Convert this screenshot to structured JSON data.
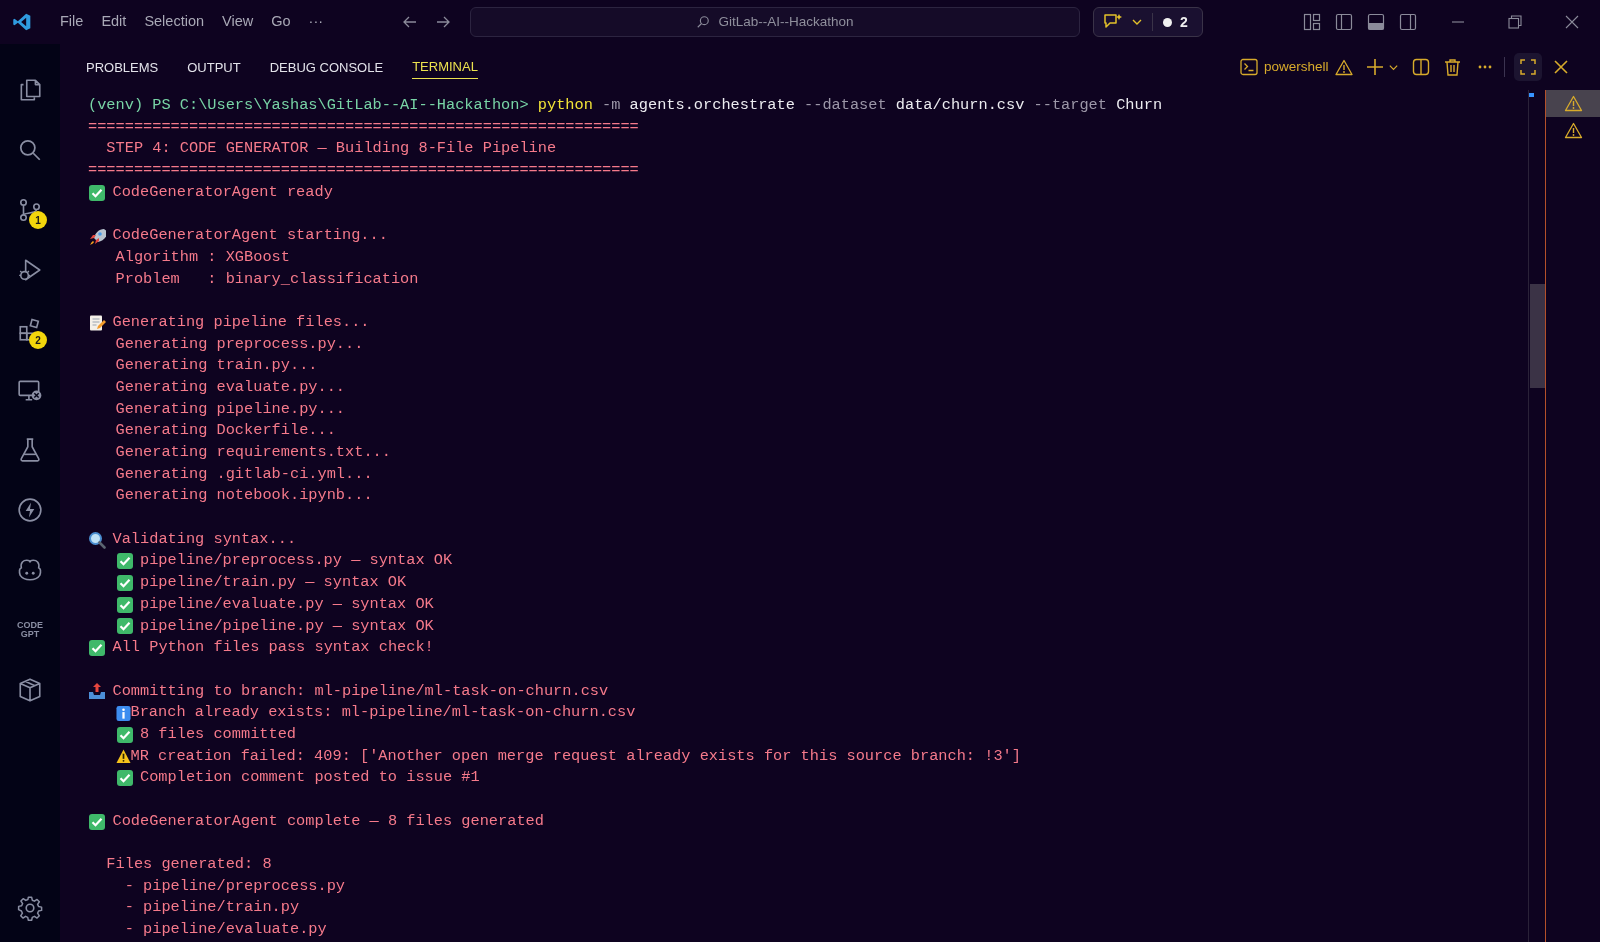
{
  "title_bar": {
    "menus": [
      "File",
      "Edit",
      "Selection",
      "View",
      "Go",
      "···"
    ],
    "search": "GitLab--AI--Hackathon",
    "chat_count": "2"
  },
  "activity_bar": [
    {
      "kind": "files"
    },
    {
      "kind": "search"
    },
    {
      "kind": "source_control",
      "badge": "1"
    },
    {
      "kind": "run_debug"
    },
    {
      "kind": "extensions",
      "badge": "2"
    },
    {
      "kind": "remote"
    },
    {
      "kind": "testing"
    },
    {
      "kind": "bolt"
    },
    {
      "kind": "robot"
    },
    {
      "kind": "codegpt",
      "label": "CODE GPT"
    },
    {
      "kind": "package"
    },
    {
      "kind": "settings"
    }
  ],
  "panel_tabs": [
    {
      "label": "PROBLEMS",
      "selected": false
    },
    {
      "label": "OUTPUT",
      "selected": false
    },
    {
      "label": "DEBUG CONSOLE",
      "selected": false
    },
    {
      "label": "TERMINAL",
      "selected": true
    }
  ],
  "terminal_toolbar": {
    "shell": "powershell"
  },
  "terminal_lines": [
    {
      "kind": "command",
      "segments": [
        {
          "text": "(venv) PS C:\\Users\\Yashas\\GitLab--AI--Hackathon>",
          "kind": "prompt"
        },
        {
          "text": "python",
          "kind": "keyword"
        },
        {
          "text": "-m",
          "kind": "flag"
        },
        {
          "text": "agents.orchestrate",
          "kind": "arg"
        },
        {
          "text": "--dataset",
          "kind": "flag"
        },
        {
          "text": "data/churn.csv",
          "kind": "arg"
        },
        {
          "text": "--target",
          "kind": "flag"
        },
        {
          "text": "Churn",
          "kind": "arg"
        }
      ]
    },
    {
      "kind": "plain",
      "text": "============================================================"
    },
    {
      "kind": "plain",
      "text": "  STEP 4: CODE GENERATOR — Building 8-File Pipeline"
    },
    {
      "kind": "plain",
      "text": "============================================================"
    },
    {
      "kind": "check",
      "text": "CodeGeneratorAgent ready"
    },
    {
      "kind": "blank"
    },
    {
      "kind": "rocket",
      "text": "CodeGeneratorAgent starting..."
    },
    {
      "kind": "plain",
      "text": "   Algorithm : XGBoost"
    },
    {
      "kind": "plain",
      "text": "   Problem   : binary_classification"
    },
    {
      "kind": "blank"
    },
    {
      "kind": "memo",
      "text": "Generating pipeline files..."
    },
    {
      "kind": "plain",
      "text": "   Generating preprocess.py..."
    },
    {
      "kind": "plain",
      "text": "   Generating train.py..."
    },
    {
      "kind": "plain",
      "text": "   Generating evaluate.py..."
    },
    {
      "kind": "plain",
      "text": "   Generating pipeline.py..."
    },
    {
      "kind": "plain",
      "text": "   Generating Dockerfile..."
    },
    {
      "kind": "plain",
      "text": "   Generating requirements.txt..."
    },
    {
      "kind": "plain",
      "text": "   Generating .gitlab-ci.yml..."
    },
    {
      "kind": "plain",
      "text": "   Generating notebook.ipynb..."
    },
    {
      "kind": "blank"
    },
    {
      "kind": "search",
      "text": "Validating syntax..."
    },
    {
      "kind": "check",
      "indented": true,
      "text": "pipeline/preprocess.py — syntax OK"
    },
    {
      "kind": "check",
      "indented": true,
      "text": "pipeline/train.py — syntax OK"
    },
    {
      "kind": "check",
      "indented": true,
      "text": "pipeline/evaluate.py — syntax OK"
    },
    {
      "kind": "check",
      "indented": true,
      "text": "pipeline/pipeline.py — syntax OK"
    },
    {
      "kind": "check",
      "text": "All Python files pass syntax check!"
    },
    {
      "kind": "blank"
    },
    {
      "kind": "outbox",
      "text": "Committing to branch: ml-pipeline/ml-task-on-churn.csv"
    },
    {
      "kind": "info",
      "indented": true,
      "text": "Branch already exists: ml-pipeline/ml-task-on-churn.csv"
    },
    {
      "kind": "check",
      "indented": true,
      "text": "8 files committed"
    },
    {
      "kind": "warning",
      "indented": true,
      "text": "MR creation failed: 409: ['Another open merge request already exists for this source branch: !3']"
    },
    {
      "kind": "check",
      "indented": true,
      "text": "Completion comment posted to issue #1"
    },
    {
      "kind": "blank"
    },
    {
      "kind": "check",
      "text": "CodeGeneratorAgent complete — 8 files generated"
    },
    {
      "kind": "blank"
    },
    {
      "kind": "plain",
      "text": "  Files generated: 8"
    },
    {
      "kind": "plain",
      "text": "    - pipeline/preprocess.py"
    },
    {
      "kind": "plain",
      "text": "    - pipeline/train.py"
    },
    {
      "kind": "plain",
      "text": "    - pipeline/evaluate.py"
    }
  ],
  "terminal_list": [
    {
      "selected": true
    },
    {
      "selected": false
    }
  ]
}
